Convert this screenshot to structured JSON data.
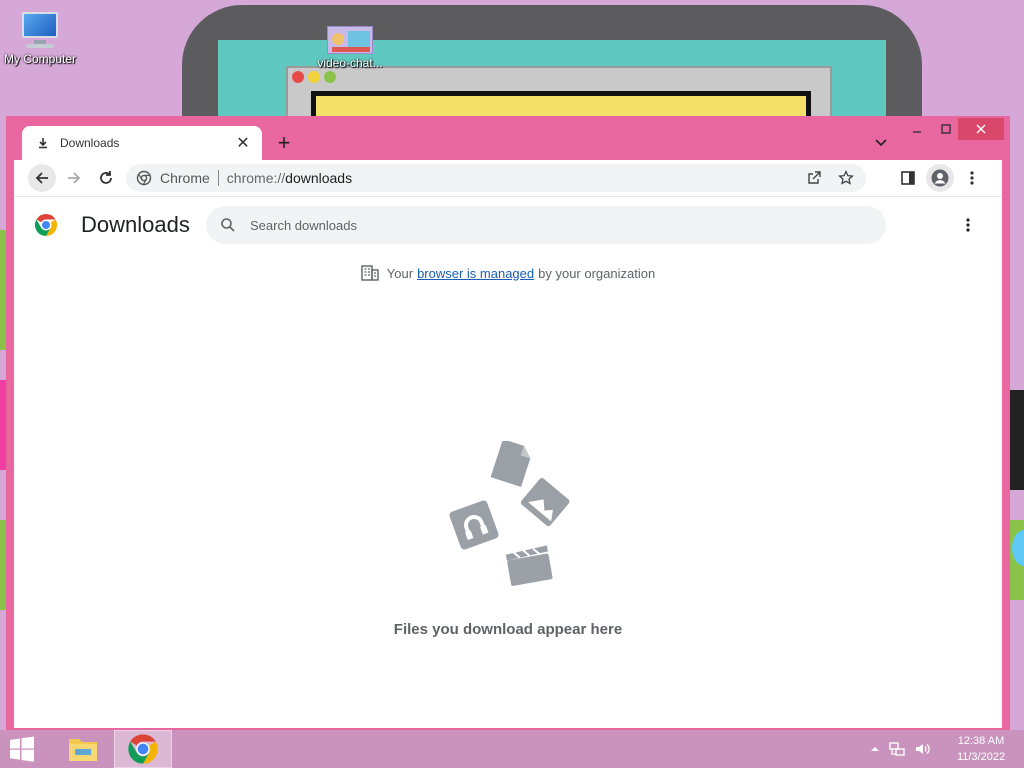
{
  "desktop": {
    "icons": [
      {
        "label": "My Computer",
        "icon": "computer-icon"
      },
      {
        "label": "video-chat...",
        "icon": "video-chat-icon"
      }
    ]
  },
  "browser": {
    "tab": {
      "title": "Downloads",
      "icon": "download-icon",
      "close": "✕"
    },
    "new_tab": "+",
    "window_controls": {
      "minimize": "minimize-icon",
      "maximize": "maximize-icon",
      "close": "✕"
    },
    "omnibox": {
      "site": "Chrome",
      "url_scheme": "chrome://",
      "url_path": "downloads"
    },
    "accent_color": "#e8679f"
  },
  "downloads": {
    "title": "Downloads",
    "search_placeholder": "Search downloads",
    "managed_prefix": "Your",
    "managed_link": "browser is managed",
    "managed_suffix": "by your organization",
    "empty_message": "Files you download appear here"
  },
  "taskbar": {
    "apps": [
      "start-icon",
      "file-explorer-icon",
      "chrome-icon"
    ],
    "time": "12:38 AM",
    "date": "11/3/2022"
  }
}
